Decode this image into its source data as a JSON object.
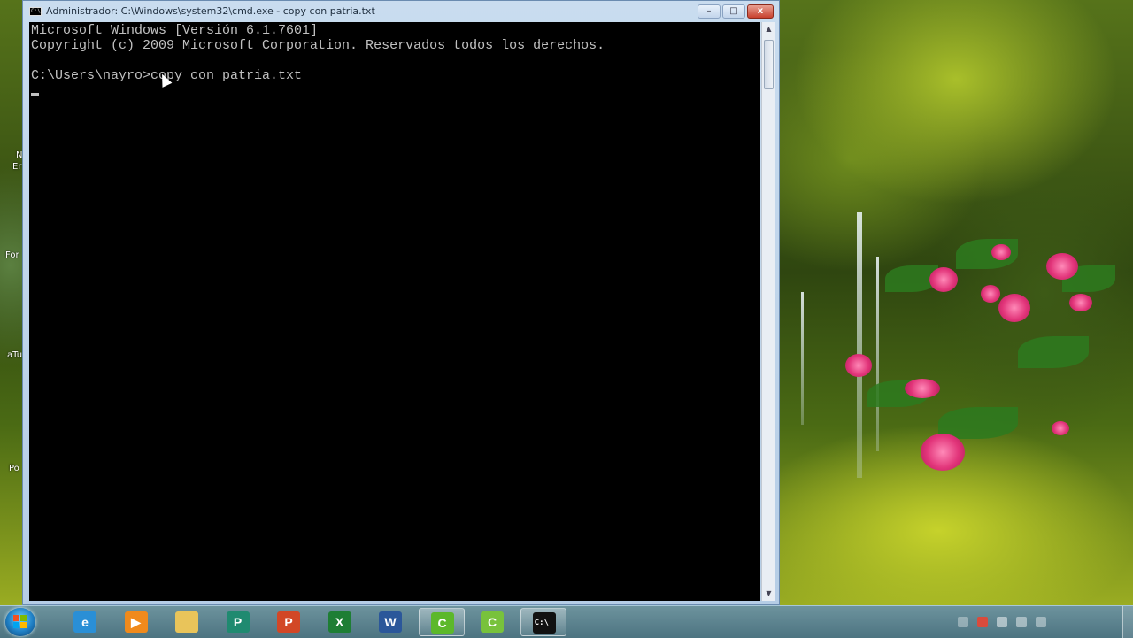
{
  "window": {
    "title": "Administrador: C:\\Windows\\system32\\cmd.exe - copy  con patria.txt",
    "icon_label": "C:\\_",
    "minimize_label": "–",
    "maximize_label": "□",
    "close_label": "x"
  },
  "console": {
    "lines": [
      "Microsoft Windows [Versión 6.1.7601]",
      "Copyright (c) 2009 Microsoft Corporation. Reservados todos los derechos.",
      "",
      "C:\\Users\\nayro>copy con patria.txt"
    ],
    "background": "#000000",
    "foreground": "#c0c0c0"
  },
  "desktop": {
    "labels": [
      "N",
      "Er",
      "For",
      "aTu",
      "Po"
    ]
  },
  "taskbar": {
    "items": [
      {
        "name": "internet-explorer-icon",
        "glyph": "e",
        "color": "#2a8fd6"
      },
      {
        "name": "media-player-icon",
        "glyph": "▶",
        "color": "#f08a1c"
      },
      {
        "name": "folder-icon",
        "glyph": "",
        "color": "#e9c45a"
      },
      {
        "name": "publisher-icon",
        "glyph": "P",
        "color": "#1f8a70"
      },
      {
        "name": "powerpoint-icon",
        "glyph": "P",
        "color": "#d24726"
      },
      {
        "name": "excel-icon",
        "glyph": "X",
        "color": "#1e7e34"
      },
      {
        "name": "word-icon",
        "glyph": "W",
        "color": "#2b579a"
      },
      {
        "name": "camtasia-icon",
        "glyph": "C",
        "color": "#5cb82a"
      },
      {
        "name": "camtasia-recorder-icon",
        "glyph": "C",
        "color": "#78c23c"
      },
      {
        "name": "cmd-icon",
        "glyph": "C:\\_",
        "color": "#111111"
      }
    ],
    "active_items": [
      7,
      9
    ],
    "accent": "#6f9fb8"
  }
}
